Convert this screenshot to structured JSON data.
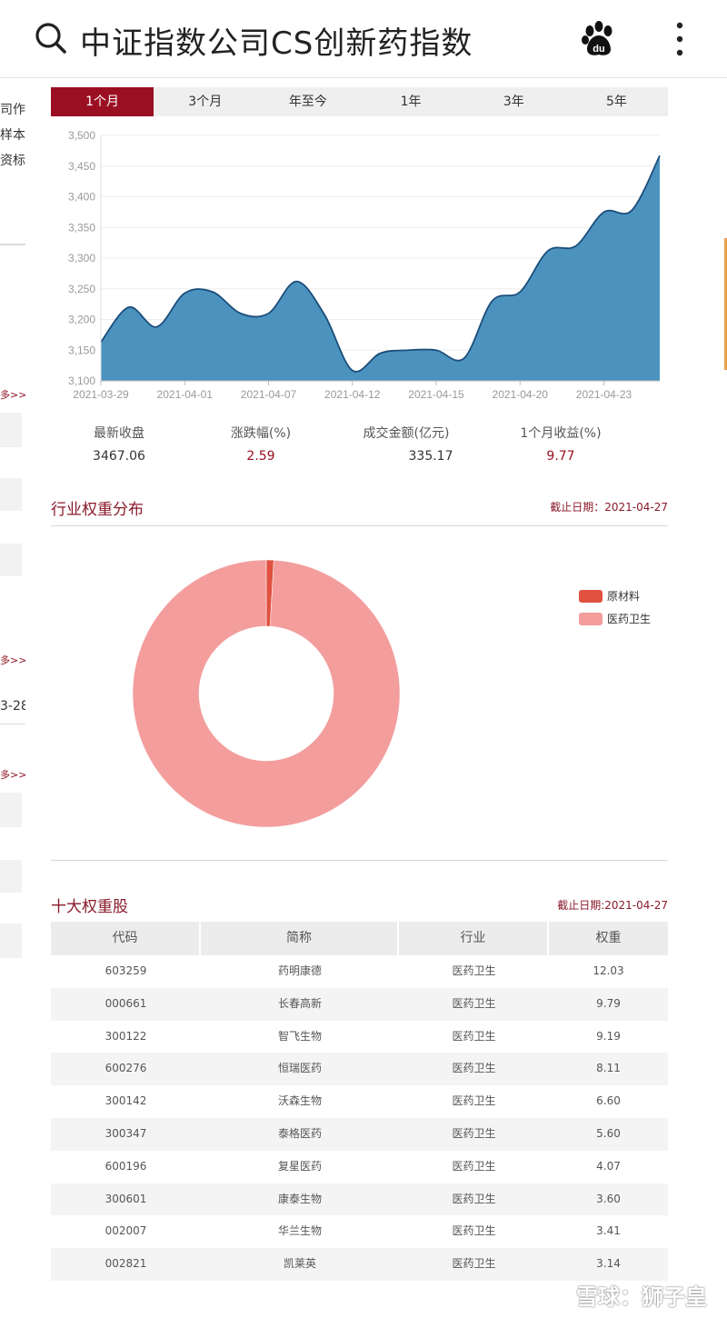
{
  "search": {
    "query": "中证指数公司CS创新药指数"
  },
  "left_fragments": {
    "l1": "司作",
    "l2": "样本",
    "l3": "资标",
    "more1": "多>>",
    "more2": "多>>",
    "date_frag": "3-28",
    "more3": "多>>"
  },
  "tabs": [
    {
      "label": "1个月",
      "active": true
    },
    {
      "label": "3个月",
      "active": false
    },
    {
      "label": "年至今",
      "active": false
    },
    {
      "label": "1年",
      "active": false
    },
    {
      "label": "3年",
      "active": false
    },
    {
      "label": "5年",
      "active": false
    }
  ],
  "chart_data": {
    "type": "area",
    "ylim": [
      3100,
      3500
    ],
    "yticks": [
      "3,500",
      "3,450",
      "3,400",
      "3,350",
      "3,300",
      "3,250",
      "3,200",
      "3,150",
      "3,100"
    ],
    "ytick_values": [
      3500,
      3450,
      3400,
      3350,
      3300,
      3250,
      3200,
      3150,
      3100
    ],
    "x_tick_labels": [
      "2021-03-29",
      "2021-04-01",
      "2021-04-07",
      "2021-04-12",
      "2021-04-15",
      "2021-04-20",
      "2021-04-23"
    ],
    "x_tick_index": [
      0,
      3,
      6,
      9,
      12,
      15,
      18
    ],
    "values": [
      3163,
      3220,
      3188,
      3243,
      3245,
      3210,
      3210,
      3262,
      3208,
      3117,
      3145,
      3150,
      3150,
      3137,
      3230,
      3245,
      3312,
      3320,
      3375,
      3378,
      3467
    ],
    "fill_color": "#4b93be",
    "line_color": "#1c4d7a"
  },
  "stats": [
    {
      "label": "最新收盘",
      "value": "3467.06",
      "red": false
    },
    {
      "label": "涨跌幅(%)",
      "value": "2.59",
      "red": true
    },
    {
      "label": "成交金额(亿元)",
      "value": "335.17",
      "red": false
    },
    {
      "label": "1个月收益(%)",
      "value": "9.77",
      "red": true
    }
  ],
  "industry": {
    "title": "行业权重分布",
    "date": "截止日期：2021-04-27",
    "pie": [
      {
        "name": "原材料",
        "value": 0.9,
        "color": "#e0513f"
      },
      {
        "name": "医药卫生",
        "value": 99.1,
        "color": "#f49d9d"
      }
    ]
  },
  "top10": {
    "title": "十大权重股",
    "date": "截止日期:2021-04-27",
    "headers": [
      "代码",
      "简称",
      "行业",
      "权重"
    ],
    "rows": [
      [
        "603259",
        "药明康德",
        "医药卫生",
        "12.03"
      ],
      [
        "000661",
        "长春高新",
        "医药卫生",
        "9.79"
      ],
      [
        "300122",
        "智飞生物",
        "医药卫生",
        "9.19"
      ],
      [
        "600276",
        "恒瑞医药",
        "医药卫生",
        "8.11"
      ],
      [
        "300142",
        "沃森生物",
        "医药卫生",
        "6.60"
      ],
      [
        "300347",
        "泰格医药",
        "医药卫生",
        "5.60"
      ],
      [
        "600196",
        "复星医药",
        "医药卫生",
        "4.07"
      ],
      [
        "300601",
        "康泰生物",
        "医药卫生",
        "3.60"
      ],
      [
        "002007",
        "华兰生物",
        "医药卫生",
        "3.41"
      ],
      [
        "002821",
        "凯莱英",
        "医药卫生",
        "3.14"
      ]
    ]
  },
  "watermark": "雪球：狮子皇"
}
